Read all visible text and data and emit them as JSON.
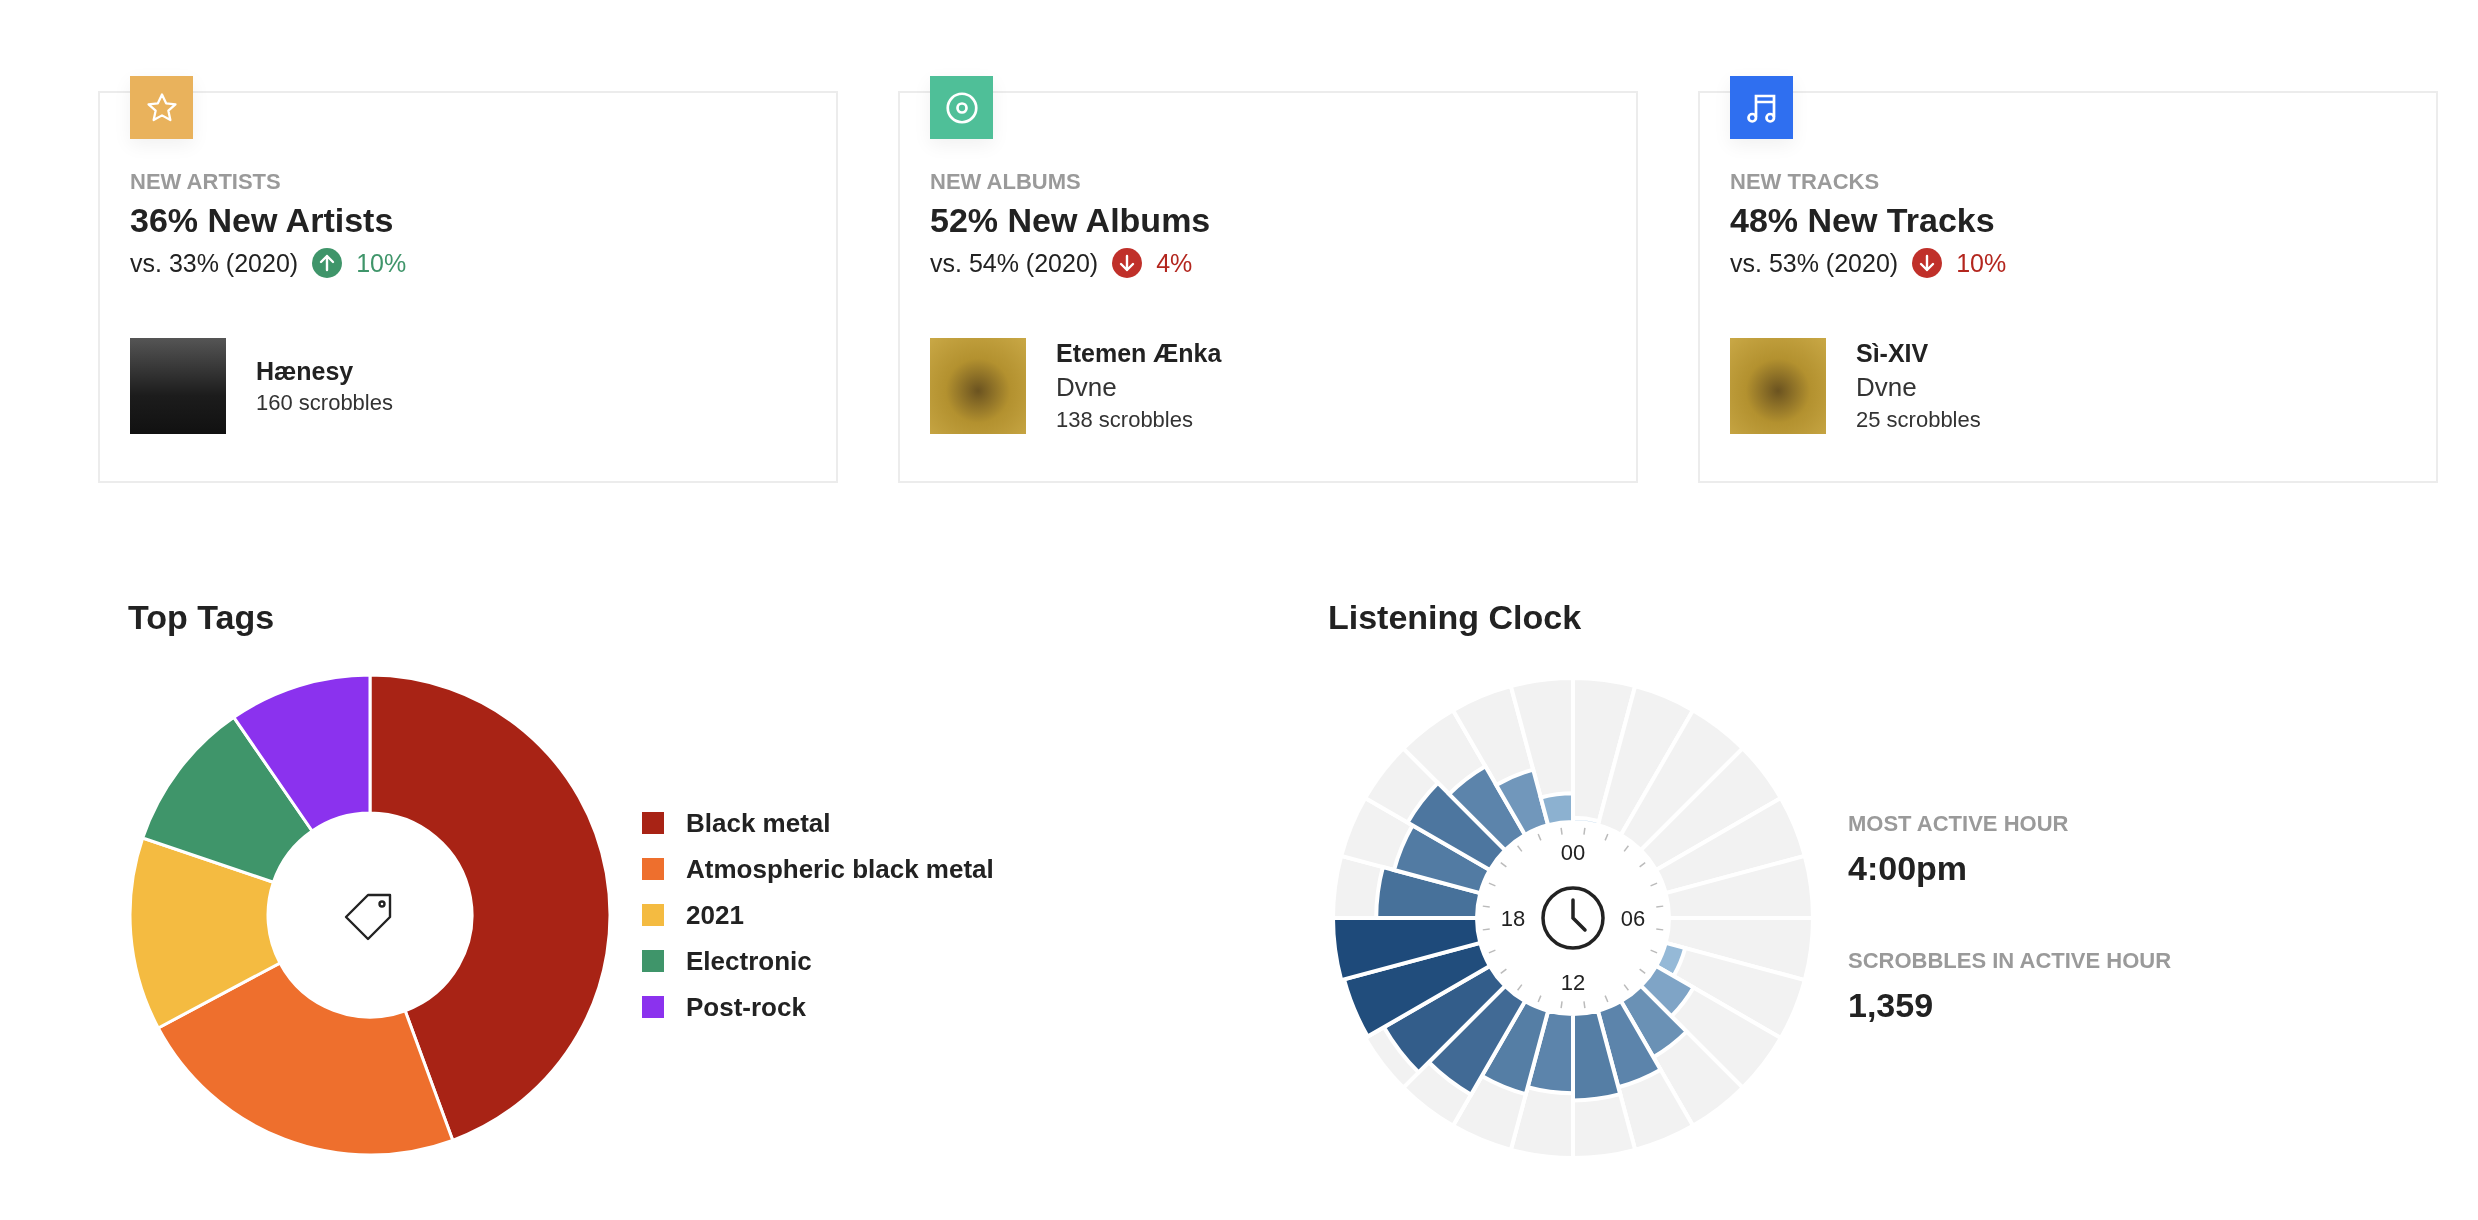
{
  "cards": [
    {
      "kind": "star",
      "color": "#e9b25c",
      "label": "NEW ARTISTS",
      "title": "36% New Artists",
      "comparison": "vs. 33% (2020)",
      "change": {
        "kind": "up",
        "text": "10%"
      },
      "item": {
        "name": "Hænesy",
        "count": "160 scrobbles"
      }
    },
    {
      "kind": "disc",
      "color": "#4fbf98",
      "label": "NEW ALBUMS",
      "title": "52% New Albums",
      "comparison": "vs. 54% (2020)",
      "change": {
        "kind": "down",
        "text": "4%"
      },
      "item": {
        "name": "Etemen Ænka",
        "subtitle": "Dvne",
        "count": "138 scrobbles"
      }
    },
    {
      "kind": "note",
      "color": "#2f6ff0",
      "label": "NEW TRACKS",
      "title": "48% New Tracks",
      "comparison": "vs. 53% (2020)",
      "change": {
        "kind": "down",
        "text": "10%"
      },
      "item": {
        "name": "Sì-XIV",
        "subtitle": "Dvne",
        "count": "25 scrobbles"
      }
    }
  ],
  "top_tags": {
    "title": "Top Tags",
    "legend": [
      {
        "label": "Black metal",
        "color": "#a82315"
      },
      {
        "label": "Atmospheric black metal",
        "color": "#ee6f2d"
      },
      {
        "label": "2021",
        "color": "#f4bb41"
      },
      {
        "label": "Electronic",
        "color": "#3f956a"
      },
      {
        "label": "Post-rock",
        "color": "#8b32ee"
      }
    ]
  },
  "listening_clock": {
    "title": "Listening Clock",
    "hour_labels": [
      "00",
      "06",
      "12",
      "18"
    ],
    "stats": [
      {
        "label": "MOST ACTIVE HOUR",
        "value": "4:00pm"
      },
      {
        "label": "SCROBBLES IN ACTIVE HOUR",
        "value": "1,359"
      }
    ]
  }
}
